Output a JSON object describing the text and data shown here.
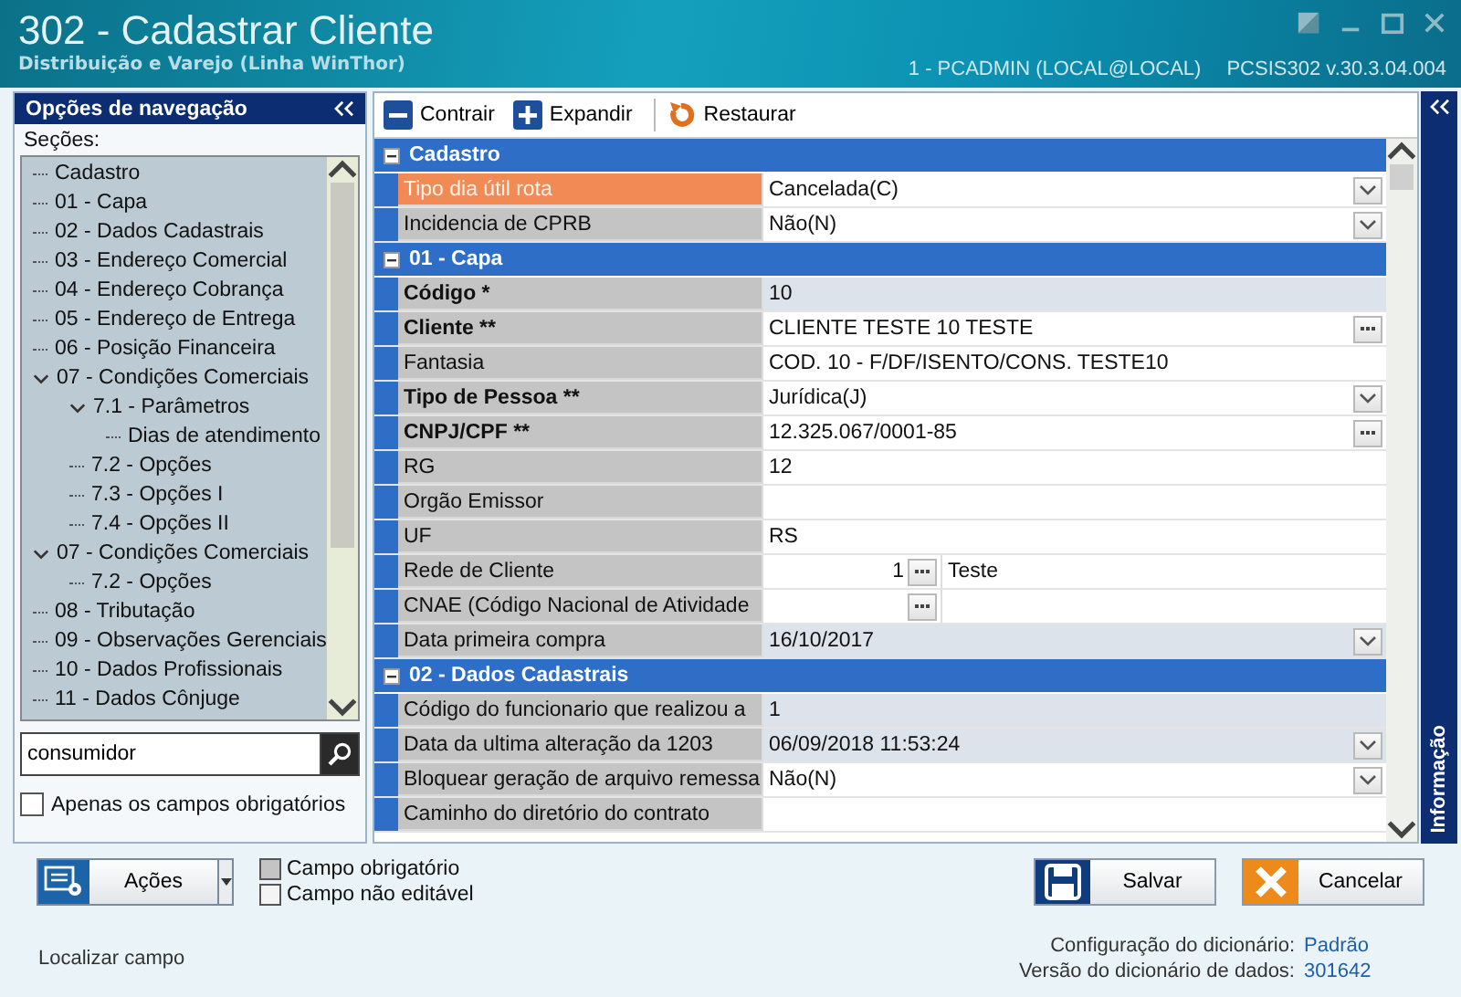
{
  "window": {
    "title": "302 - Cadastrar Cliente",
    "subtitle": "Distribuição e Varejo (Linha WinThor)",
    "user": "1 - PCADMIN (LOCAL@LOCAL)",
    "version": "PCSIS302  v.30.3.04.004"
  },
  "navigation": {
    "title": "Opções de navegação",
    "sections_label": "Seções:",
    "tree": [
      {
        "label": "Cadastro"
      },
      {
        "label": "01 - Capa"
      },
      {
        "label": "02 - Dados Cadastrais"
      },
      {
        "label": "03 - Endereço Comercial"
      },
      {
        "label": "04 - Endereço Cobrança"
      },
      {
        "label": "05 - Endereço de Entrega"
      },
      {
        "label": "06 - Posição Financeira"
      },
      {
        "label": "07 - Condições Comerciais",
        "expanded": true,
        "children": [
          {
            "label": "7.1 - Parâmetros",
            "expanded": true,
            "children": [
              {
                "label": "Dias de atendimento"
              }
            ]
          },
          {
            "label": "7.2 - Opções"
          },
          {
            "label": "7.3 - Opções I"
          },
          {
            "label": "7.4 - Opções II"
          }
        ]
      },
      {
        "label": "07 - Condições Comerciais",
        "expanded": true,
        "children": [
          {
            "label": "7.2 - Opções"
          }
        ]
      },
      {
        "label": "08 - Tributação"
      },
      {
        "label": "09 - Observações Gerenciais"
      },
      {
        "label": "10 - Dados Profissionais"
      },
      {
        "label": "11 - Dados Cônjuge"
      }
    ],
    "search": {
      "value": "consumidor"
    },
    "only_required": {
      "label": "Apenas os campos obrigatórios",
      "checked": false
    }
  },
  "toolbar": [
    {
      "kind": "collapse",
      "label": "Contrair"
    },
    {
      "kind": "expand",
      "label": "Expandir"
    },
    {
      "kind": "restore",
      "label": "Restaurar"
    }
  ],
  "sections": [
    {
      "title": "Cadastro",
      "rows": [
        {
          "label": "Tipo dia útil rota",
          "value": "Cancelada(C)",
          "kind": "dropdown",
          "required": false,
          "editable": true,
          "selected": true
        },
        {
          "label": "Incidencia de CPRB",
          "value": "Não(N)",
          "kind": "dropdown",
          "required": false,
          "editable": true,
          "selected": false
        }
      ]
    },
    {
      "title": "01 - Capa",
      "rows": [
        {
          "label": "Código *",
          "value": "10",
          "kind": "text",
          "required": true,
          "editable": false,
          "selected": false
        },
        {
          "label": "Cliente **",
          "value": "CLIENTE TESTE 10 TESTE",
          "kind": "ellipsis",
          "required": true,
          "editable": true,
          "selected": false
        },
        {
          "label": "Fantasia",
          "value": "COD. 10 - F/DF/ISENTO/CONS. TESTE10",
          "kind": "text",
          "required": false,
          "editable": true,
          "selected": false
        },
        {
          "label": "Tipo de Pessoa **",
          "value": "Jurídica(J)",
          "kind": "dropdown",
          "required": true,
          "editable": true,
          "selected": false
        },
        {
          "label": "CNPJ/CPF **",
          "value": "12.325.067/0001-85",
          "kind": "ellipsis",
          "required": true,
          "editable": true,
          "selected": false
        },
        {
          "label": "RG",
          "value": "12",
          "kind": "text",
          "required": false,
          "editable": true,
          "selected": false
        },
        {
          "label": "Orgão Emissor",
          "kind": "text",
          "required": false,
          "editable": true,
          "selected": false
        },
        {
          "label": "UF",
          "value": "RS",
          "kind": "text",
          "required": false,
          "editable": true,
          "selected": false
        },
        {
          "label": "Rede de Cliente",
          "value": "1",
          "description": "Teste",
          "kind": "lookup",
          "required": false,
          "editable": true,
          "selected": false
        },
        {
          "label": "CNAE (Código Nacional de Atividade",
          "kind": "lookup",
          "required": false,
          "editable": true,
          "selected": false
        },
        {
          "label": "Data primeira compra",
          "value": "16/10/2017",
          "kind": "dropdown",
          "required": false,
          "editable": false,
          "selected": false
        }
      ]
    },
    {
      "title": "02 - Dados Cadastrais",
      "rows": [
        {
          "label": "Código do funcionario que realizou a",
          "value": "1",
          "kind": "text",
          "required": false,
          "editable": false,
          "selected": false
        },
        {
          "label": "Data da ultima alteração da 1203",
          "value": "06/09/2018 11:53:24",
          "kind": "dropdown",
          "required": false,
          "editable": false,
          "selected": false
        },
        {
          "label": "Bloquear geração de arquivo remessa",
          "value": "Não(N)",
          "kind": "dropdown",
          "required": false,
          "editable": true,
          "selected": false
        },
        {
          "label": "Caminho do diretório do contrato",
          "kind": "text",
          "required": false,
          "editable": true,
          "selected": false
        }
      ]
    }
  ],
  "info_tab": "Informação",
  "actions_button": "Ações",
  "legend": [
    {
      "kind": "required",
      "label": "Campo obrigatório"
    },
    {
      "kind": "readonly",
      "label": "Campo não editável"
    }
  ],
  "buttons": [
    {
      "kind": "save",
      "label": "Salvar"
    },
    {
      "kind": "cancel",
      "label": "Cancelar"
    }
  ],
  "footer": {
    "find_field": "Localizar campo",
    "dictionary_config_label": "Configuração do dicionário:",
    "dictionary_config": "Padrão",
    "dictionary_version_label": "Versão do dicionário de dados:",
    "dictionary_version": "301642"
  }
}
